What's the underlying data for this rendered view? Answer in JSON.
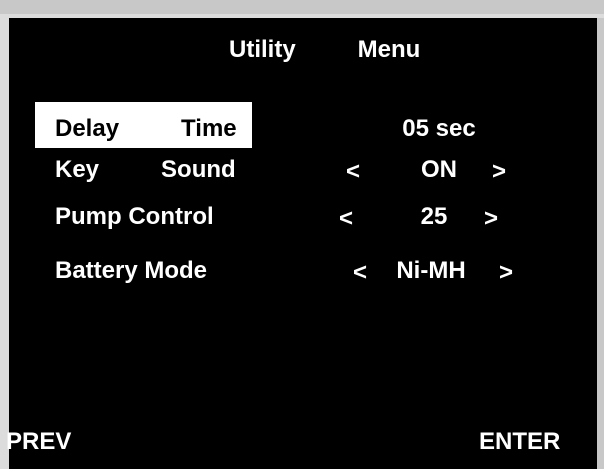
{
  "title": "Utility   Menu",
  "rows": [
    {
      "label": "Delay   Time",
      "value": "05 sec",
      "selected": true
    },
    {
      "label": "Key   Sound",
      "value": "ON",
      "left_arrow": "<",
      "right_arrow": ">"
    },
    {
      "label": "Pump Control",
      "value": "25",
      "left_arrow": "<",
      "right_arrow": ">"
    },
    {
      "label": "Battery Mode",
      "value": "Ni-MH",
      "left_arrow": "<",
      "right_arrow": ">"
    }
  ],
  "softkeys": {
    "left": "PREV",
    "right": "ENTER"
  },
  "colors": {
    "background": "#000000",
    "text": "#ffffff",
    "selection": "#ffffff",
    "bezel": "#c8c8c8"
  }
}
